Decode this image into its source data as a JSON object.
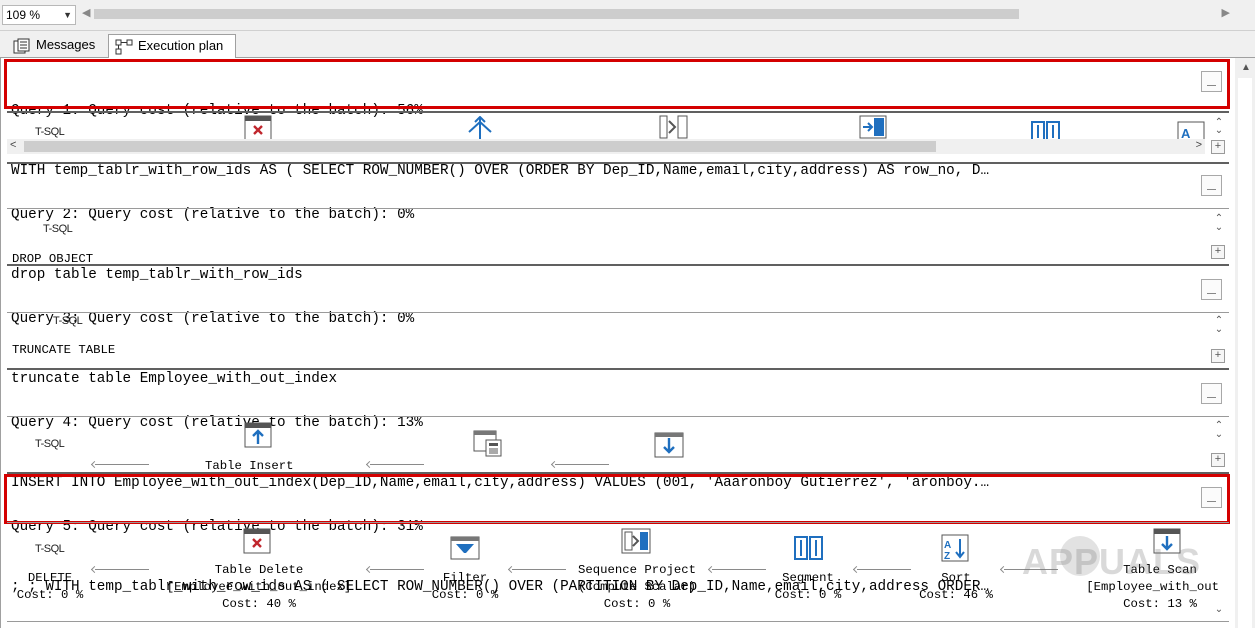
{
  "toolbar": {
    "zoom": "109 %"
  },
  "tabs": [
    {
      "label": "Messages",
      "icon": "messages-icon"
    },
    {
      "label": "Execution plan",
      "icon": "execution-plan-icon"
    }
  ],
  "queries": [
    {
      "header": "Query 1: Query cost (relative to the batch): 56%",
      "sql": "WITH temp_tablr_with_row_ids AS ( SELECT ROW_NUMBER() OVER (ORDER BY Dep_ID,Name,email,city,address) AS row_no, D…",
      "root": "T-SQL"
    },
    {
      "header": "Query 2: Query cost (relative to the batch): 0%",
      "sql": "drop table temp_tablr_with_row_ids",
      "root": "T-SQL",
      "op": "DROP OBJECT"
    },
    {
      "header": "Query 3: Query cost (relative to the batch): 0%",
      "sql": "truncate table Employee_with_out_index",
      "root": "T-SQL",
      "op": "TRUNCATE TABLE"
    },
    {
      "header": "Query 4: Query cost (relative to the batch): 13%",
      "sql": "INSERT INTO Employee_with_out_index(Dep_ID,Name,email,city,address) VALUES (001, 'Aaaronboy Gutierrez', 'aronboy.…",
      "root": "T-SQL",
      "op": "Table Insert"
    },
    {
      "header": "Query 5: Query cost (relative to the batch): 31%",
      "sql": "; ; WITH temp_tablr_with_row_ids AS ( SELECT ROW_NUMBER() OVER (PARTITION BY Dep_ID,Name,email,city,address ORDER…",
      "root": "T-SQL",
      "operators": [
        {
          "line1": "DELETE",
          "line2": "",
          "cost": "Cost: 0 %"
        },
        {
          "line1": "Table Delete",
          "line2": "[Employee_with_out_index]",
          "cost": "Cost: 40 %"
        },
        {
          "line1": "Filter",
          "line2": "",
          "cost": "Cost: 0 %"
        },
        {
          "line1": "Sequence Project",
          "line2": "(Compute Scalar)",
          "cost": "Cost: 0 %"
        },
        {
          "line1": "Segment",
          "line2": "",
          "cost": "Cost: 0 %"
        },
        {
          "line1": "Sort",
          "line2": "",
          "cost": "Cost: 46 %"
        },
        {
          "line1": "Table Scan",
          "line2": "[Employee_with_out_i",
          "cost": "Cost: 13 %"
        }
      ]
    }
  ],
  "watermark": "APPUALS",
  "colors": {
    "highlight": "#d40000",
    "icon_blue": "#1f6fbf",
    "icon_red": "#c0262d"
  }
}
